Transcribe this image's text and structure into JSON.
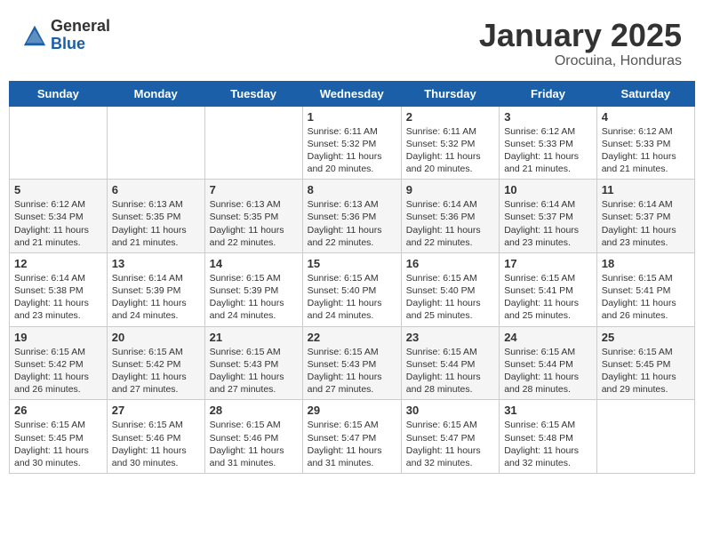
{
  "header": {
    "logo_general": "General",
    "logo_blue": "Blue",
    "month": "January 2025",
    "location": "Orocuina, Honduras"
  },
  "days_of_week": [
    "Sunday",
    "Monday",
    "Tuesday",
    "Wednesday",
    "Thursday",
    "Friday",
    "Saturday"
  ],
  "weeks": [
    [
      {
        "day": "",
        "info": ""
      },
      {
        "day": "",
        "info": ""
      },
      {
        "day": "",
        "info": ""
      },
      {
        "day": "1",
        "info": "Sunrise: 6:11 AM\nSunset: 5:32 PM\nDaylight: 11 hours and 20 minutes."
      },
      {
        "day": "2",
        "info": "Sunrise: 6:11 AM\nSunset: 5:32 PM\nDaylight: 11 hours and 20 minutes."
      },
      {
        "day": "3",
        "info": "Sunrise: 6:12 AM\nSunset: 5:33 PM\nDaylight: 11 hours and 21 minutes."
      },
      {
        "day": "4",
        "info": "Sunrise: 6:12 AM\nSunset: 5:33 PM\nDaylight: 11 hours and 21 minutes."
      }
    ],
    [
      {
        "day": "5",
        "info": "Sunrise: 6:12 AM\nSunset: 5:34 PM\nDaylight: 11 hours and 21 minutes."
      },
      {
        "day": "6",
        "info": "Sunrise: 6:13 AM\nSunset: 5:35 PM\nDaylight: 11 hours and 21 minutes."
      },
      {
        "day": "7",
        "info": "Sunrise: 6:13 AM\nSunset: 5:35 PM\nDaylight: 11 hours and 22 minutes."
      },
      {
        "day": "8",
        "info": "Sunrise: 6:13 AM\nSunset: 5:36 PM\nDaylight: 11 hours and 22 minutes."
      },
      {
        "day": "9",
        "info": "Sunrise: 6:14 AM\nSunset: 5:36 PM\nDaylight: 11 hours and 22 minutes."
      },
      {
        "day": "10",
        "info": "Sunrise: 6:14 AM\nSunset: 5:37 PM\nDaylight: 11 hours and 23 minutes."
      },
      {
        "day": "11",
        "info": "Sunrise: 6:14 AM\nSunset: 5:37 PM\nDaylight: 11 hours and 23 minutes."
      }
    ],
    [
      {
        "day": "12",
        "info": "Sunrise: 6:14 AM\nSunset: 5:38 PM\nDaylight: 11 hours and 23 minutes."
      },
      {
        "day": "13",
        "info": "Sunrise: 6:14 AM\nSunset: 5:39 PM\nDaylight: 11 hours and 24 minutes."
      },
      {
        "day": "14",
        "info": "Sunrise: 6:15 AM\nSunset: 5:39 PM\nDaylight: 11 hours and 24 minutes."
      },
      {
        "day": "15",
        "info": "Sunrise: 6:15 AM\nSunset: 5:40 PM\nDaylight: 11 hours and 24 minutes."
      },
      {
        "day": "16",
        "info": "Sunrise: 6:15 AM\nSunset: 5:40 PM\nDaylight: 11 hours and 25 minutes."
      },
      {
        "day": "17",
        "info": "Sunrise: 6:15 AM\nSunset: 5:41 PM\nDaylight: 11 hours and 25 minutes."
      },
      {
        "day": "18",
        "info": "Sunrise: 6:15 AM\nSunset: 5:41 PM\nDaylight: 11 hours and 26 minutes."
      }
    ],
    [
      {
        "day": "19",
        "info": "Sunrise: 6:15 AM\nSunset: 5:42 PM\nDaylight: 11 hours and 26 minutes."
      },
      {
        "day": "20",
        "info": "Sunrise: 6:15 AM\nSunset: 5:42 PM\nDaylight: 11 hours and 27 minutes."
      },
      {
        "day": "21",
        "info": "Sunrise: 6:15 AM\nSunset: 5:43 PM\nDaylight: 11 hours and 27 minutes."
      },
      {
        "day": "22",
        "info": "Sunrise: 6:15 AM\nSunset: 5:43 PM\nDaylight: 11 hours and 27 minutes."
      },
      {
        "day": "23",
        "info": "Sunrise: 6:15 AM\nSunset: 5:44 PM\nDaylight: 11 hours and 28 minutes."
      },
      {
        "day": "24",
        "info": "Sunrise: 6:15 AM\nSunset: 5:44 PM\nDaylight: 11 hours and 28 minutes."
      },
      {
        "day": "25",
        "info": "Sunrise: 6:15 AM\nSunset: 5:45 PM\nDaylight: 11 hours and 29 minutes."
      }
    ],
    [
      {
        "day": "26",
        "info": "Sunrise: 6:15 AM\nSunset: 5:45 PM\nDaylight: 11 hours and 30 minutes."
      },
      {
        "day": "27",
        "info": "Sunrise: 6:15 AM\nSunset: 5:46 PM\nDaylight: 11 hours and 30 minutes."
      },
      {
        "day": "28",
        "info": "Sunrise: 6:15 AM\nSunset: 5:46 PM\nDaylight: 11 hours and 31 minutes."
      },
      {
        "day": "29",
        "info": "Sunrise: 6:15 AM\nSunset: 5:47 PM\nDaylight: 11 hours and 31 minutes."
      },
      {
        "day": "30",
        "info": "Sunrise: 6:15 AM\nSunset: 5:47 PM\nDaylight: 11 hours and 32 minutes."
      },
      {
        "day": "31",
        "info": "Sunrise: 6:15 AM\nSunset: 5:48 PM\nDaylight: 11 hours and 32 minutes."
      },
      {
        "day": "",
        "info": ""
      }
    ]
  ]
}
